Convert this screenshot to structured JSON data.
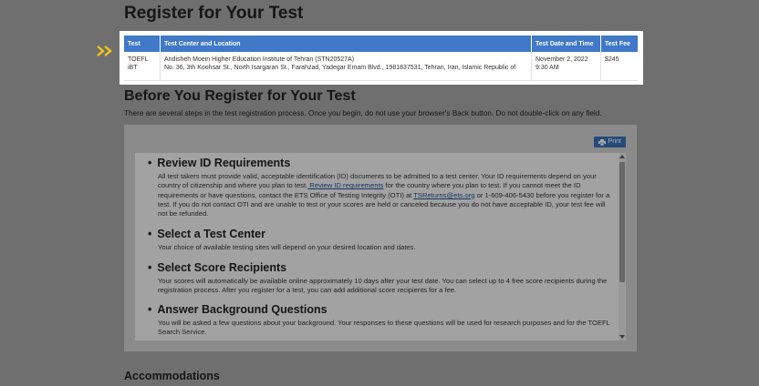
{
  "page": {
    "title": "Register for Your Test",
    "before_title": "Before You Register for Your Test",
    "intro": "There are several steps in the test registration process. Once you begin, do not use your browser's Back button. Do not double-click on any field.",
    "print_label": "Print",
    "accommodations_title": "Accommodations"
  },
  "test_table": {
    "headers": [
      "Test",
      "Test Center and Location",
      "Test Date and Time",
      "Test Fee"
    ],
    "row": {
      "test": "TOEFL iBT",
      "center_name": "Andisheh Moein Higher Education Institute of Tehran (STN20527A)",
      "center_address": "No. 36, 3th Koohsar St., North Isargaran St., Farahzad, Yadegar Emam Blvd., 1981837531, Tehran, Iran, Islamic Republic of",
      "date": "November 2, 2022",
      "time": "9:30 AM",
      "fee": "$245"
    }
  },
  "steps": [
    {
      "title": "Review ID Requirements",
      "text_before_link": "All test takers must provide valid, acceptable identification (ID) documents to be admitted to a test center. Your ID requirements depend on your country of citizenship and where you plan to test.",
      "link": " Review ID requirements",
      "text_mid": " for the country where you plan to test. If you cannot meet the ID requirements or have questions, contact the ETS Office of Testing Integrity (OTI) at ",
      "email": "TSReturns@ets.org",
      "text_after": " or 1-609-406-5430 before you register for a test. If you do not contact OTI and are unable to test or your scores are held or canceled because you do not have acceptable ID, your test fee will not be refunded."
    },
    {
      "title": "Select a Test Center",
      "text": "Your choice of available testing sites will depend on your desired location and dates."
    },
    {
      "title": "Select Score Recipients",
      "text": "Your scores will automatically be available online approximately 10 days after your test date. You can select up to 4 free score recipients during the registration process. After you register for a test, you can add additional score recipients for a fee."
    },
    {
      "title": "Answer Background Questions",
      "text": "You will be asked a few questions about your background. Your responses to these questions will be used for research purposes and for the TOEFL Search Service."
    }
  ],
  "colors": {
    "table_header": "#3f79c8",
    "pointer": "#f5c518",
    "link": "#1f4f8f"
  }
}
